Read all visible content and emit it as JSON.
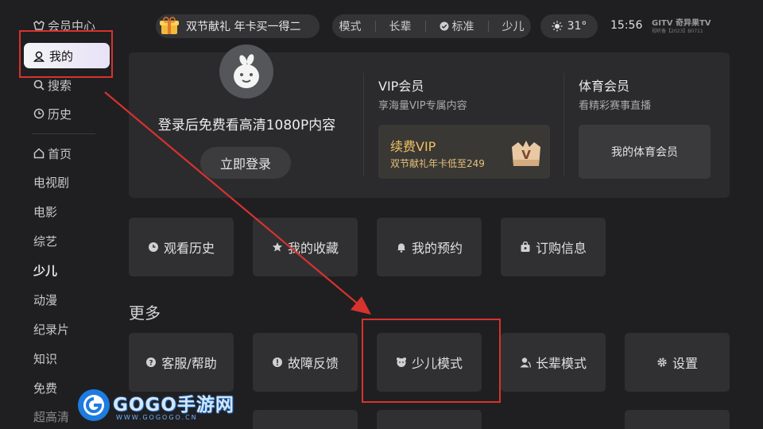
{
  "sidebar": {
    "items": [
      {
        "label": "会员中心",
        "icon": "vip-icon"
      },
      {
        "label": "我的",
        "icon": "user-icon",
        "selected": true
      },
      {
        "label": "搜索",
        "icon": "search-icon"
      },
      {
        "label": "历史",
        "icon": "clock-icon"
      },
      {
        "label": "首页",
        "icon": "home-icon"
      },
      {
        "label": "电视剧"
      },
      {
        "label": "电影"
      },
      {
        "label": "综艺"
      },
      {
        "label": "少儿"
      },
      {
        "label": "动漫"
      },
      {
        "label": "纪录片"
      },
      {
        "label": "知识"
      },
      {
        "label": "免费"
      },
      {
        "label": "超高清"
      }
    ]
  },
  "topbar": {
    "promo": "双节献礼 年卡买一得二",
    "modes": [
      "模式",
      "长辈",
      "标准",
      "少儿"
    ],
    "weather": {
      "icon": "sun-icon",
      "temp": "31°"
    },
    "time": "15:56",
    "brand": "GITV 奇异果TV",
    "license": "视听备【2023】B0711"
  },
  "account": {
    "login_prompt": "登录后免费看高清1080P内容",
    "login_button": "立即登录",
    "vip": {
      "title": "VIP会员",
      "subtitle": "享海量VIP专属内容",
      "card_title": "续费VIP",
      "card_sub": "双节献礼年卡低至249",
      "badge": "V"
    },
    "sport": {
      "title": "体育会员",
      "subtitle": "看精彩赛事直播",
      "card_label": "我的体育会员"
    }
  },
  "quick": [
    {
      "label": "观看历史",
      "icon": "clock-icon"
    },
    {
      "label": "我的收藏",
      "icon": "star-icon"
    },
    {
      "label": "我的预约",
      "icon": "bell-icon"
    },
    {
      "label": "订购信息",
      "icon": "bag-icon"
    }
  ],
  "more": {
    "title": "更多",
    "items": [
      {
        "label": "客服/帮助",
        "icon": "help-icon"
      },
      {
        "label": "故障反馈",
        "icon": "alert-icon"
      },
      {
        "label": "少儿模式",
        "icon": "kid-icon"
      },
      {
        "label": "长辈模式",
        "icon": "elder-icon"
      },
      {
        "label": "设置",
        "icon": "gear-icon"
      }
    ]
  },
  "watermark": {
    "text": "GOGO手游网",
    "url": "WWW.GOGOGO.CN"
  },
  "colors": {
    "background": "#1f1f21",
    "annotation": "#d8322e",
    "vip_gold": "#f0c060"
  }
}
